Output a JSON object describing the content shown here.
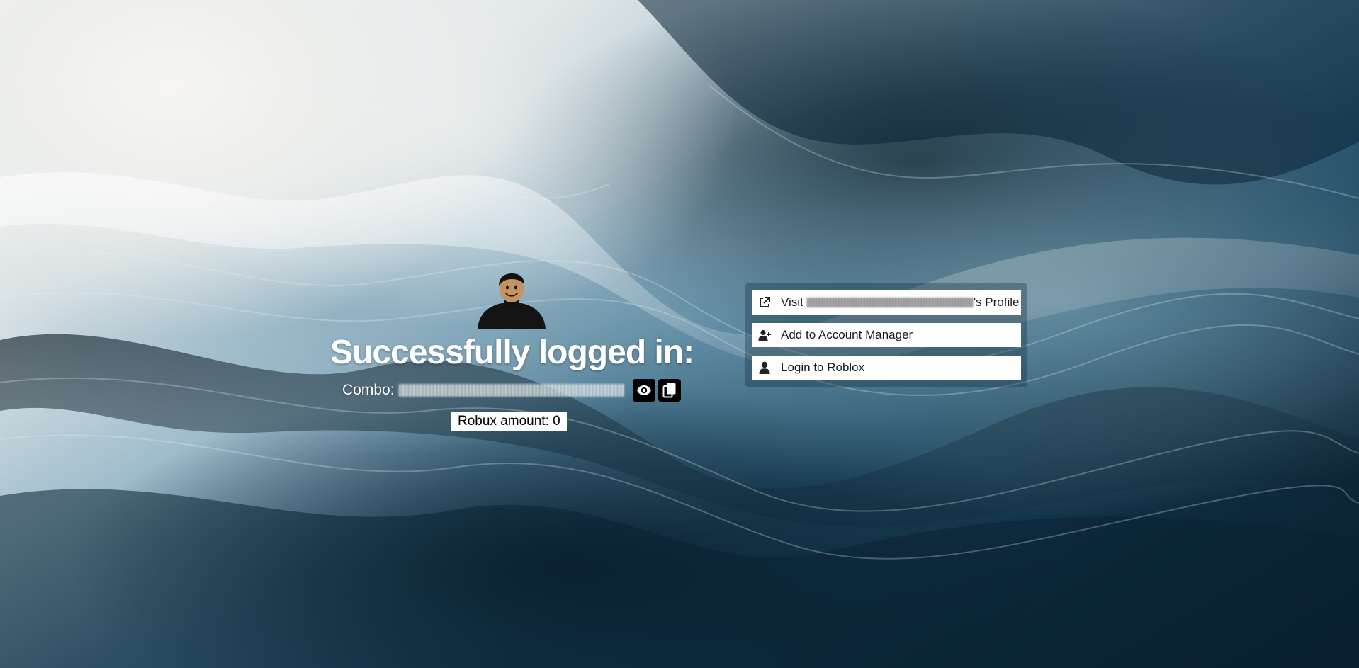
{
  "background": {
    "accent_dark": "#0e2a3d",
    "accent_light": "#f3f3ef"
  },
  "login": {
    "avatar_icon": "roblox-avatar-icon",
    "title": "Successfully logged in:",
    "combo_label": "Combo:",
    "combo_value_state": "blurred",
    "show_icon": "eye-icon",
    "copy_icon": "copy-icon",
    "robux_text": "Robux amount: 0"
  },
  "actions": {
    "visit": {
      "icon": "external-link-icon",
      "prefix": "Visit",
      "suffix": "'s Profile"
    },
    "account_manager": {
      "icon": "user-plus-icon",
      "label": "Add to Account Manager"
    },
    "login_roblox": {
      "icon": "user-icon",
      "label": "Login to Roblox"
    }
  }
}
